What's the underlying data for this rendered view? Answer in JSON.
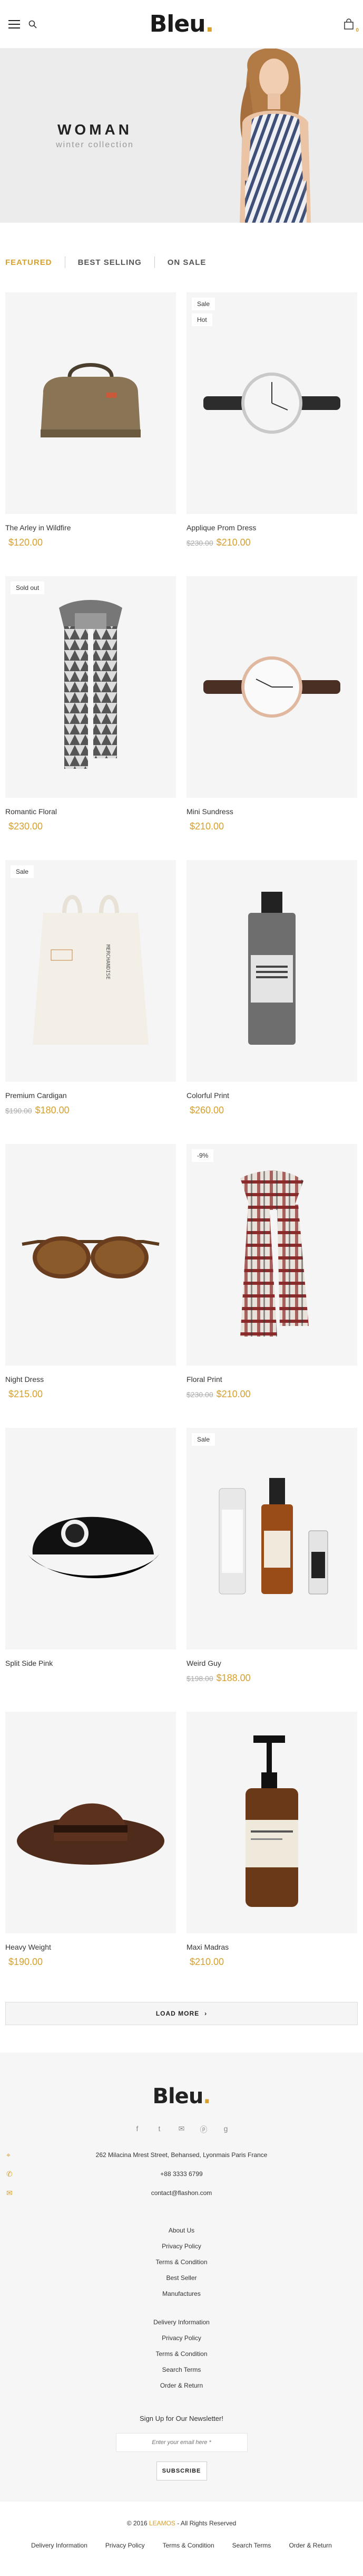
{
  "header": {
    "logo": "Bleu",
    "logo_dot": ".",
    "cart_count": "0"
  },
  "hero": {
    "title": "WOMAN",
    "subtitle": "winter collection"
  },
  "tabs": [
    "FEATURED",
    "BEST SELLING",
    "ON SALE"
  ],
  "products": [
    {
      "name": "The Arley in Wildfire",
      "price": "$120.00",
      "old_price": "",
      "badges": []
    },
    {
      "name": "Applique Prom Dress",
      "price": "$210.00",
      "old_price": "$230.00",
      "badges": [
        "Sale",
        "Hot"
      ]
    },
    {
      "name": "Romantic Floral",
      "price": "$230.00",
      "old_price": "",
      "badges": [
        "Sold out"
      ]
    },
    {
      "name": "Mini Sundress",
      "price": "$210.00",
      "old_price": "",
      "badges": []
    },
    {
      "name": "Premium Cardigan",
      "price": "$180.00",
      "old_price": "$190.00",
      "badges": [
        "Sale"
      ]
    },
    {
      "name": "Colorful Print",
      "price": "$260.00",
      "old_price": "",
      "badges": []
    },
    {
      "name": "Night Dress",
      "price": "$215.00",
      "old_price": "",
      "badges": []
    },
    {
      "name": "Floral Print",
      "price": "$210.00",
      "old_price": "$230.00",
      "badges": [
        "-9%"
      ]
    },
    {
      "name": "Split Side Pink",
      "price": "",
      "old_price": "",
      "badges": []
    },
    {
      "name": "Weird Guy",
      "price": "$188.00",
      "old_price": "$198.00",
      "badges": [
        "Sale"
      ]
    },
    {
      "name": "Heavy Weight",
      "price": "$190.00",
      "old_price": "",
      "badges": []
    },
    {
      "name": "Maxi Madras",
      "price": "$210.00",
      "old_price": "",
      "badges": []
    }
  ],
  "load_more": "LOAD MORE",
  "footer": {
    "logo": "Bleu",
    "address": "262 Milacina Mrest Street, Behansed, Lyonmais Paris France",
    "phone": "+88 3333 6799",
    "email": "contact@flashon.com",
    "links1": [
      "About Us",
      "Privacy Policy",
      "Terms & Condition",
      "Best Seller",
      "Manufactures"
    ],
    "links2": [
      "Delivery Information",
      "Privacy Policy",
      "Terms & Condition",
      "Search Terms",
      "Order & Return"
    ],
    "newsletter_title": "Sign Up for Our Newsletter!",
    "newsletter_placeholder": "Enter your email here *",
    "subscribe": "SUBSCRIBE"
  },
  "bottom": {
    "copyright_pre": "© 2016",
    "copyright_brand": "LEAMOS",
    "copyright_post": "- All Rights Reserved",
    "links": [
      "Delivery Information",
      "Privacy Policy",
      "Terms & Condition",
      "Search Terms",
      "Order & Return"
    ]
  },
  "colors": {
    "accent": "#d8a02c"
  }
}
